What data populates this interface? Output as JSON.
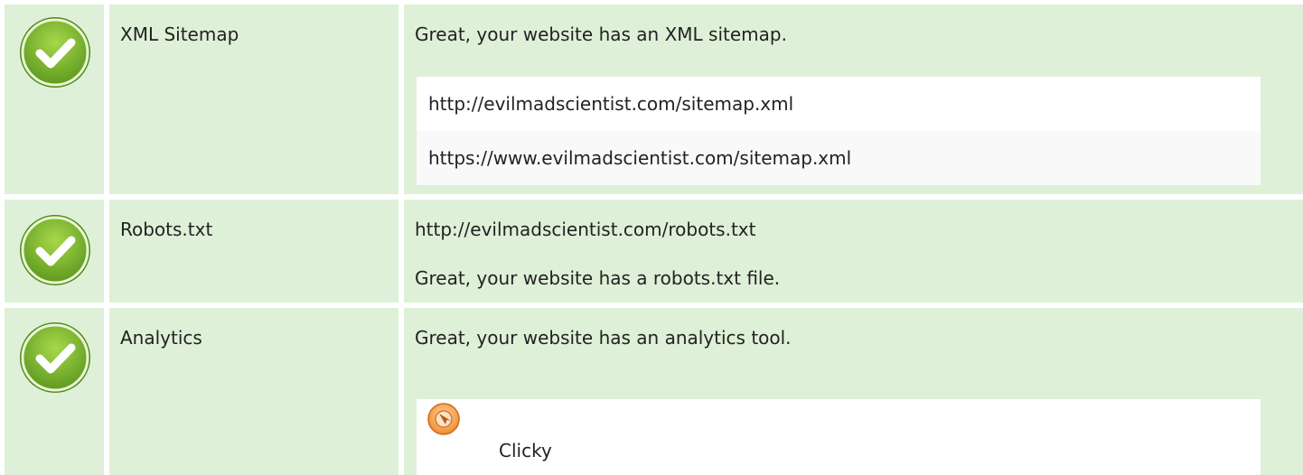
{
  "rows": [
    {
      "label": "XML Sitemap",
      "message": "Great, your website has an XML sitemap.",
      "urls": [
        "http://evilmadscientist.com/sitemap.xml",
        "https://www.evilmadscientist.com/sitemap.xml"
      ],
      "status_icon": "check-circle-icon"
    },
    {
      "label": "Robots.txt",
      "url": "http://evilmadscientist.com/robots.txt",
      "message": "Great, your website has a robots.txt file.",
      "status_icon": "check-circle-icon"
    },
    {
      "label": "Analytics",
      "message": "Great, your website has an analytics tool.",
      "tools": [
        "Clicky"
      ],
      "status_icon": "check-circle-icon"
    }
  ],
  "colors": {
    "row_bg": "#dff0d8",
    "check_green": "#7ab82e",
    "text": "#222222"
  }
}
